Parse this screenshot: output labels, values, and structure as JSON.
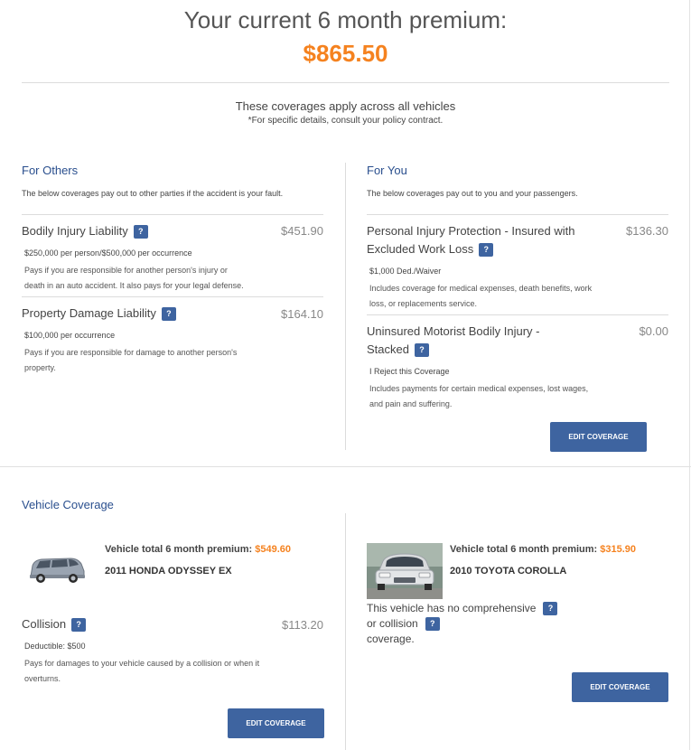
{
  "premium": {
    "title": "Your current 6 month premium:",
    "amount": "$865.50"
  },
  "coverage_note": {
    "main": "These coverages apply across all vehicles",
    "sub": "*For specific details, consult your policy contract."
  },
  "for_others": {
    "heading": "For Others",
    "description": "The below coverages pay out to other parties if the accident is your fault.",
    "items": [
      {
        "name": "Bodily Injury Liability",
        "price": "$451.90",
        "limit": "$250,000 per person/$500,000 per occurrence",
        "desc_lines": [
          "Pays if you are responsible for another person's injury or",
          "death in an auto accident. It also pays for your legal defense."
        ]
      },
      {
        "name": "Property Damage Liability",
        "price": "$164.10",
        "limit": "$100,000 per occurrence",
        "desc_lines": [
          "Pays if you are responsible for damage to another person's",
          "property."
        ]
      }
    ]
  },
  "for_you": {
    "heading": "For You",
    "description": "The below coverages pay out to you and your passengers.",
    "items": [
      {
        "name_lines": [
          "Personal Injury Protection - Insured with",
          "Excluded Work Loss"
        ],
        "price": "$136.30",
        "limit": "$1,000 Ded./Waiver",
        "desc_lines": [
          "Includes coverage for medical expenses, death benefits, work",
          "loss, or replacements service."
        ]
      },
      {
        "name_lines": [
          "Uninsured Motorist Bodily Injury -",
          "Stacked"
        ],
        "price": "$0.00",
        "limit": "I Reject this Coverage",
        "desc_lines": [
          "Includes payments for certain medical expenses, lost wages,",
          "and pain and suffering."
        ]
      }
    ],
    "edit_label": "EDIT COVERAGE"
  },
  "vehicle_coverage": {
    "heading": "Vehicle Coverage",
    "vehicles": [
      {
        "total_label": "Vehicle total 6 month premium:",
        "total_amount": "$549.60",
        "name": "2011 HONDA ODYSSEY EX",
        "coverage": {
          "name": "Collision",
          "price": "$113.20",
          "limit": "Deductible: $500",
          "desc_lines": [
            "Pays for damages to your vehicle caused by a collision or when it",
            "overturns."
          ]
        },
        "edit_label": "EDIT COVERAGE"
      },
      {
        "total_label": "Vehicle total 6 month premium:",
        "total_amount": "$315.90",
        "name": "2010 TOYOTA COROLLA",
        "no_coverage_lines": [
          "This vehicle has no comprehensive",
          "or collision",
          "coverage."
        ],
        "edit_label": "EDIT COVERAGE"
      }
    ]
  },
  "help_glyph": "?",
  "colors": {
    "accent_orange": "#f5821f",
    "heading_blue": "#2a4f8e",
    "button_blue": "#3e64a0"
  }
}
